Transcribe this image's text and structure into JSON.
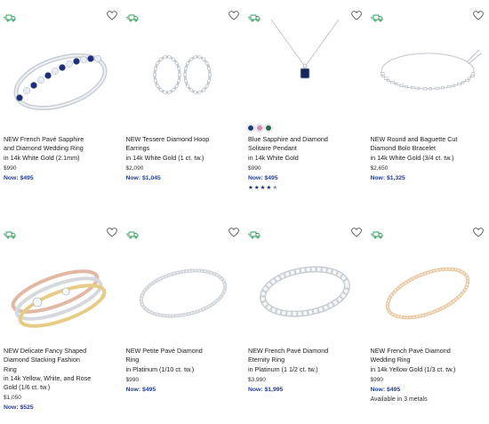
{
  "products": [
    {
      "title_lines": [
        "NEW French Pavé Sapphire",
        "and Diamond Wedding Ring",
        "in 14k White Gold (2.1mm)"
      ],
      "price": "$990",
      "now": "Now: $495",
      "image": "sapphire-diamond-band",
      "swatches": [],
      "rating": null,
      "availability": ""
    },
    {
      "title_lines": [
        "NEW Tessere Diamond Hoop",
        "Earrings",
        "in 14k White Gold (1 ct. tw.)"
      ],
      "price": "$2,090",
      "now": "Now: $1,045",
      "image": "diamond-hoop-earrings",
      "swatches": [],
      "rating": null,
      "availability": ""
    },
    {
      "title_lines": [
        "Blue Sapphire and Diamond",
        "Solitaire Pendant",
        "in 14k White Gold"
      ],
      "price": "$990",
      "now": "Now: $495",
      "image": "sapphire-pendant",
      "swatches": [
        "#1d3b8e",
        "#e089b6",
        "#2e6b4e"
      ],
      "rating": 4.5,
      "availability": ""
    },
    {
      "title_lines": [
        "NEW Round and Baguette Cut",
        "Diamond Bolo Bracelet",
        "in 14k White Gold (3/4 ct. tw.)"
      ],
      "price": "$2,650",
      "now": "Now: $1,325",
      "image": "bolo-bracelet",
      "swatches": [],
      "rating": null,
      "availability": ""
    },
    {
      "title_lines": [
        "NEW Delicate Fancy Shaped",
        "Diamond Stacking Fashion",
        "Ring",
        "in 14k Yellow, White, and Rose",
        "Gold (1/6 ct. tw.)"
      ],
      "price": "$1,050",
      "now": "Now: $525",
      "image": "stacking-ring",
      "swatches": [],
      "rating": null,
      "availability": ""
    },
    {
      "title_lines": [
        "NEW Petite Pavé Diamond",
        "Ring",
        "in Platinum (1/10 ct. tw.)"
      ],
      "price": "$990",
      "now": "Now: $495",
      "image": "petite-pave-ring",
      "swatches": [],
      "rating": null,
      "availability": ""
    },
    {
      "title_lines": [
        "NEW French Pavé Diamond",
        "Eternity Ring",
        "in Platinum (1 1/2 ct. tw.)"
      ],
      "price": "$3,990",
      "now": "Now: $1,995",
      "image": "eternity-ring",
      "swatches": [],
      "rating": null,
      "availability": ""
    },
    {
      "title_lines": [
        "NEW French Pavé Diamond",
        "Wedding Ring",
        "in 14k Yellow Gold (1/3 ct. tw.)"
      ],
      "price": "$990",
      "now": "Now: $495",
      "image": "yellow-gold-pave-ring",
      "swatches": [],
      "rating": null,
      "availability": "Available in 3 metals"
    }
  ],
  "icons": {
    "shipping": "delivery-truck-icon",
    "wishlist": "heart-outline-icon"
  },
  "colors": {
    "sale_price": "#1f3d9b",
    "shipping_icon": "#2e9b5a"
  }
}
